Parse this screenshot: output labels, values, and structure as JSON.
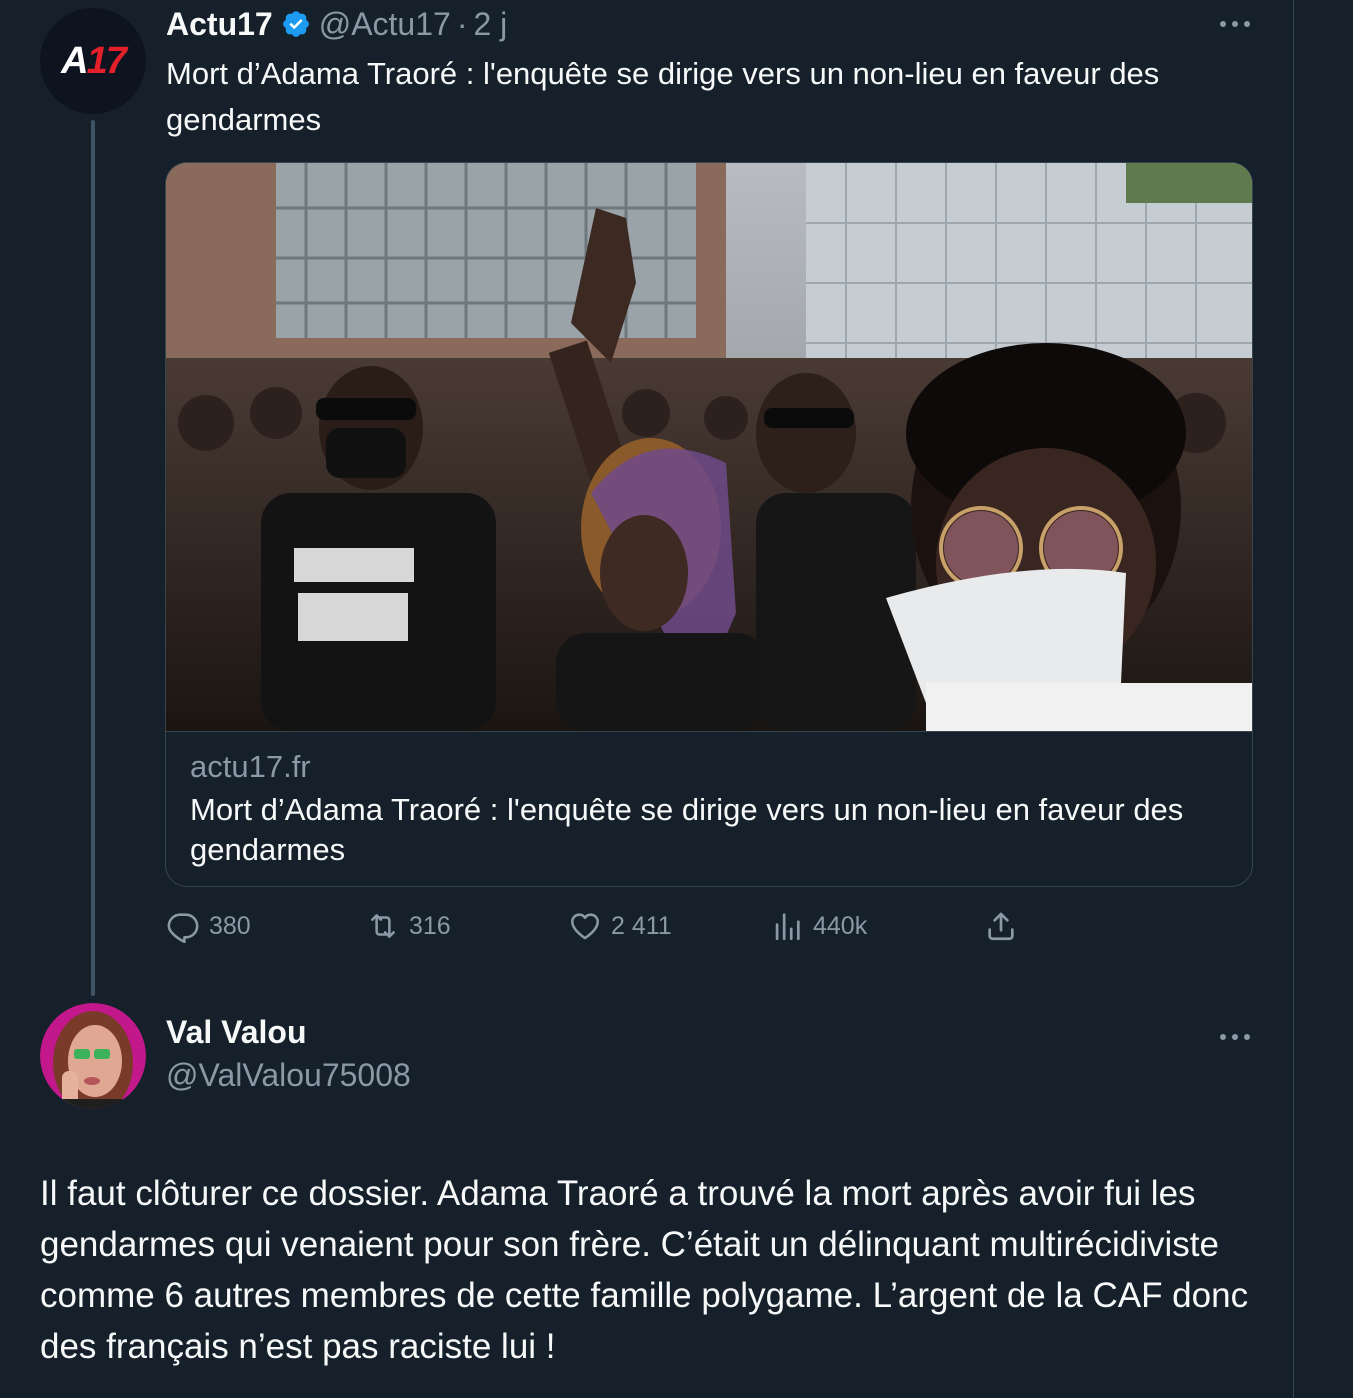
{
  "tweet1": {
    "author_name": "Actu17",
    "verified": true,
    "handle": "@Actu17",
    "separator": "·",
    "time": "2 j",
    "avatar_logo": {
      "a": "A",
      "num": "17"
    },
    "text": "Mort d’Adama Traoré : l'enquête se dirige vers un non-lieu en faveur des gendarmes",
    "link_card": {
      "image_icon": "protest-crowd-photo",
      "domain": "actu17.fr",
      "title": "Mort d’Adama Traoré : l'enquête se dirige vers un non-lieu en faveur des gendarmes"
    },
    "actions": {
      "replies": "380",
      "retweets": "316",
      "likes": "2 411",
      "views": "440k"
    }
  },
  "tweet2": {
    "author_name": "Val Valou",
    "handle": "@ValValou75008",
    "avatar_icon": "user-photo-avatar",
    "text": "Il faut clôturer ce dossier. Adama Traoré a trouvé la mort après avoir fui les gendarmes qui venaient pour son frère. C’était un délinquant multirécidiviste comme 6 autres membres de cette famille polygame. L’argent de la CAF donc des français n’est pas raciste lui !"
  },
  "colors": {
    "background": "#15202b",
    "text_primary": "#f7f9f9",
    "text_secondary": "#8b98a5",
    "border": "#38444d",
    "verified_blue": "#1d9bf0",
    "brand_red": "#e3202a"
  }
}
